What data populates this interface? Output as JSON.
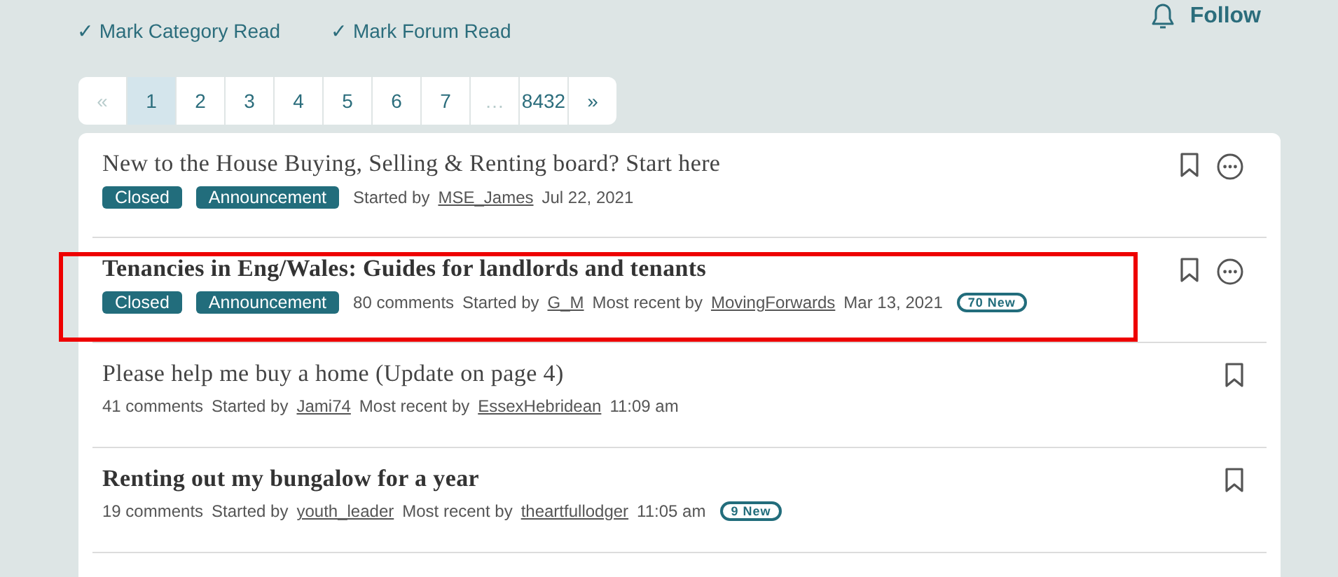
{
  "actions": [
    {
      "label": "✓ Mark Category Read"
    },
    {
      "label": "✓ Mark Forum Read"
    }
  ],
  "follow": {
    "label": "Follow"
  },
  "pagination": [
    {
      "label": "«",
      "kind": "nav",
      "selected": false
    },
    {
      "label": "1",
      "kind": "page",
      "selected": true
    },
    {
      "label": "2",
      "kind": "page",
      "selected": false
    },
    {
      "label": "3",
      "kind": "page",
      "selected": false
    },
    {
      "label": "4",
      "kind": "page",
      "selected": false
    },
    {
      "label": "5",
      "kind": "page",
      "selected": false
    },
    {
      "label": "6",
      "kind": "page",
      "selected": false
    },
    {
      "label": "7",
      "kind": "page",
      "selected": false
    },
    {
      "label": "…",
      "kind": "gap",
      "selected": false
    },
    {
      "label": "8432",
      "kind": "page",
      "selected": false
    },
    {
      "label": "»",
      "kind": "next",
      "selected": false
    }
  ],
  "threads": [
    {
      "title": "New to the House Buying, Selling & Renting board? Start here",
      "unread": false,
      "highlighted": false,
      "options": true,
      "meta": [
        {
          "kind": "tag",
          "text": "Closed"
        },
        {
          "kind": "tag",
          "text": "Announcement"
        },
        {
          "kind": "text",
          "text": "Started by"
        },
        {
          "kind": "link",
          "text": "MSE_James"
        },
        {
          "kind": "text",
          "text": "Jul 22, 2021"
        }
      ]
    },
    {
      "title": "Tenancies in Eng/Wales: Guides for landlords and tenants",
      "unread": true,
      "highlighted": true,
      "options": true,
      "meta": [
        {
          "kind": "tag",
          "text": "Closed"
        },
        {
          "kind": "tag",
          "text": "Announcement"
        },
        {
          "kind": "text",
          "text": "80 comments"
        },
        {
          "kind": "text",
          "text": "Started by"
        },
        {
          "kind": "link",
          "text": "G_M"
        },
        {
          "kind": "text",
          "text": "Most recent by"
        },
        {
          "kind": "link",
          "text": "MovingForwards"
        },
        {
          "kind": "text",
          "text": "Mar 13, 2021"
        },
        {
          "kind": "badge",
          "text": "70 New"
        }
      ]
    },
    {
      "title": "Please help me buy a home (Update on page 4)",
      "unread": false,
      "highlighted": false,
      "options": false,
      "meta": [
        {
          "kind": "text",
          "text": "41 comments"
        },
        {
          "kind": "text",
          "text": "Started by"
        },
        {
          "kind": "link",
          "text": "Jami74"
        },
        {
          "kind": "text",
          "text": "Most recent by"
        },
        {
          "kind": "link",
          "text": "EssexHebridean"
        },
        {
          "kind": "text",
          "text": "11:09 am"
        }
      ]
    },
    {
      "title": "Renting out my bungalow for a year",
      "unread": true,
      "highlighted": false,
      "options": false,
      "meta": [
        {
          "kind": "text",
          "text": "19 comments"
        },
        {
          "kind": "text",
          "text": "Started by"
        },
        {
          "kind": "link",
          "text": "youth_leader"
        },
        {
          "kind": "text",
          "text": "Most recent by"
        },
        {
          "kind": "link",
          "text": "theartfullodger"
        },
        {
          "kind": "text",
          "text": "11:05 am"
        },
        {
          "kind": "badge",
          "text": "9 New"
        }
      ]
    }
  ]
}
